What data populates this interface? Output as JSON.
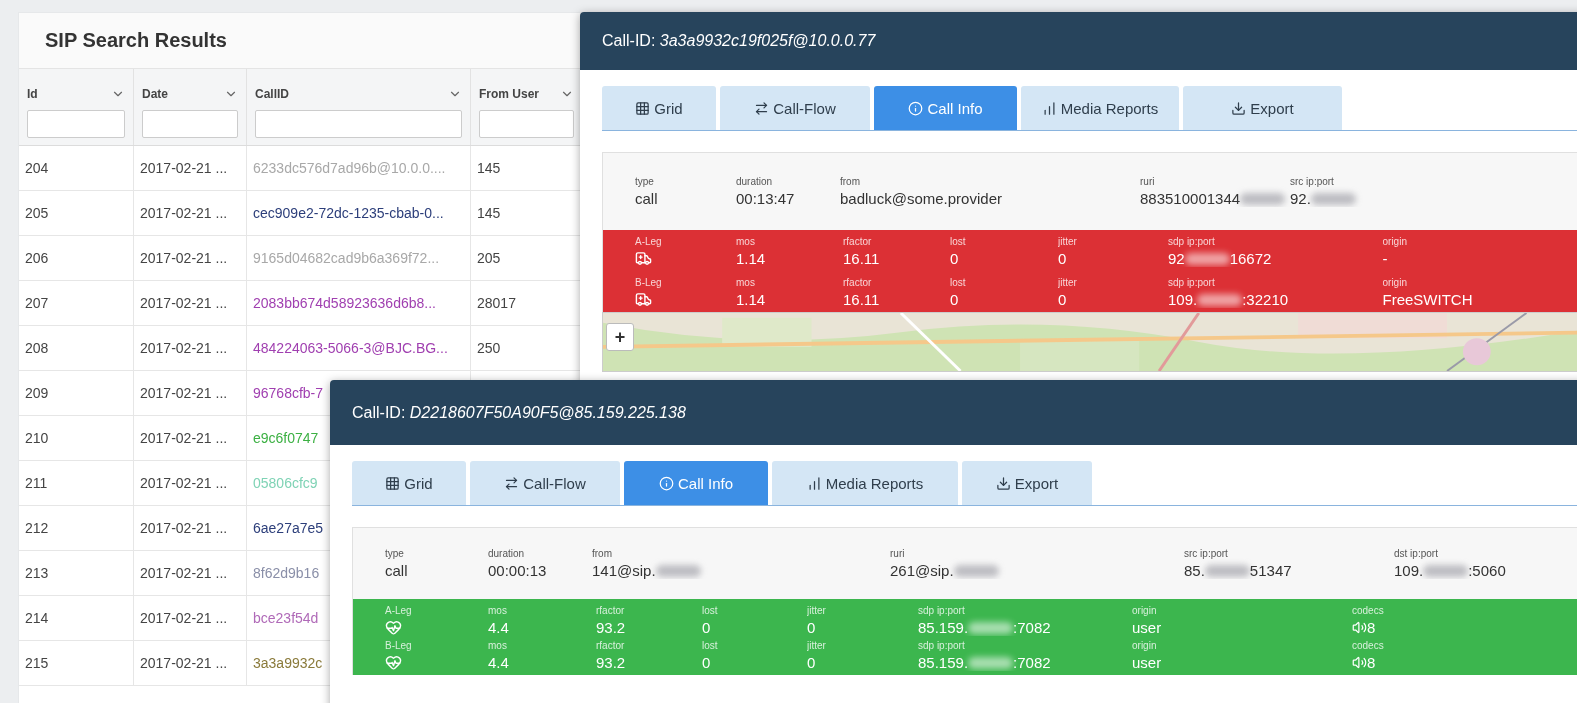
{
  "results": {
    "title": "SIP Search Results",
    "columns": [
      {
        "label": "Id"
      },
      {
        "label": "Date"
      },
      {
        "label": "CallID"
      },
      {
        "label": "From User"
      }
    ],
    "rows": [
      {
        "id": "204",
        "date": "2017-02-21 ...",
        "callid": "6233dc576d7ad96b@10.0.0....",
        "color": "#a8a8a8",
        "from_user": "145"
      },
      {
        "id": "205",
        "date": "2017-02-21 ...",
        "callid": "cec909e2-72dc-1235-cbab-0...",
        "color": "#2c3e7a",
        "from_user": "145"
      },
      {
        "id": "206",
        "date": "2017-02-21 ...",
        "callid": "9165d04682cad9b6a369f72...",
        "color": "#a8a8a8",
        "from_user": "205"
      },
      {
        "id": "207",
        "date": "2017-02-21 ...",
        "callid": "2083bb674d58923636d6b8...",
        "color": "#a03fb0",
        "from_user": "28017"
      },
      {
        "id": "208",
        "date": "2017-02-21 ...",
        "callid": "484224063-5066-3@BJC.BG...",
        "color": "#a03fb0",
        "from_user": "250"
      },
      {
        "id": "209",
        "date": "2017-02-21 ...",
        "callid": "96768cfb-7",
        "color": "#a03fb0"
      },
      {
        "id": "210",
        "date": "2017-02-21 ...",
        "callid": "e9c6f0747",
        "color": "#3cb043"
      },
      {
        "id": "211",
        "date": "2017-02-21 ...",
        "callid": "05806cfc9",
        "color": "#7fd3b5"
      },
      {
        "id": "212",
        "date": "2017-02-21 ...",
        "callid": "6ae27a7e5",
        "color": "#2c3e7a"
      },
      {
        "id": "213",
        "date": "2017-02-21 ...",
        "callid": "8f62d9b16",
        "color": "#8a8fa8"
      },
      {
        "id": "214",
        "date": "2017-02-21 ...",
        "callid": "bce23f54d",
        "color": "#b06ab8"
      },
      {
        "id": "215",
        "date": "2017-02-21 ...",
        "callid": "3a3a9932c",
        "color": "#8a7a3a"
      }
    ]
  },
  "dialogs": [
    {
      "title_label": "Call-ID:",
      "call_id": "3a3a9932c19f025f@10.0.0.77",
      "tabs": [
        {
          "label": "Grid",
          "selected": false
        },
        {
          "label": "Call-Flow",
          "selected": false
        },
        {
          "label": "Call Info",
          "selected": true
        },
        {
          "label": "Media Reports",
          "selected": false
        },
        {
          "label": "Export",
          "selected": false
        }
      ],
      "info": [
        {
          "label": "type",
          "segments": [
            {
              "text": "call"
            }
          ]
        },
        {
          "label": "duration",
          "segments": [
            {
              "text": "00:13:47"
            }
          ]
        },
        {
          "label": "from",
          "segments": [
            {
              "text": "badluck@some.provider"
            }
          ]
        },
        {
          "label": "ruri",
          "segments": [
            {
              "text": "883510001344"
            },
            {
              "kind": "blur"
            }
          ]
        },
        {
          "label": "src ip:port",
          "segments": [
            {
              "text": "92."
            },
            {
              "kind": "blur"
            }
          ]
        }
      ],
      "kind": "bad",
      "legs": [
        {
          "label": "A-Leg",
          "fields": [
            {
              "label": "mos",
              "segments": [
                {
                  "text": "1.14"
                }
              ]
            },
            {
              "label": "rfactor",
              "segments": [
                {
                  "text": "16.11"
                }
              ]
            },
            {
              "label": "lost",
              "segments": [
                {
                  "text": "0"
                }
              ]
            },
            {
              "label": "jitter",
              "segments": [
                {
                  "text": "0"
                }
              ]
            },
            {
              "label": "sdp ip:port",
              "segments": [
                {
                  "text": "92"
                },
                {
                  "kind": "blur"
                },
                {
                  "text": "16672"
                }
              ]
            },
            {
              "label": "origin",
              "segments": [
                {
                  "text": "-"
                }
              ]
            }
          ]
        },
        {
          "label": "B-Leg",
          "fields": [
            {
              "label": "mos",
              "segments": [
                {
                  "text": "1.14"
                }
              ]
            },
            {
              "label": "rfactor",
              "segments": [
                {
                  "text": "16.11"
                }
              ]
            },
            {
              "label": "lost",
              "segments": [
                {
                  "text": "0"
                }
              ]
            },
            {
              "label": "jitter",
              "segments": [
                {
                  "text": "0"
                }
              ]
            },
            {
              "label": "sdp ip:port",
              "segments": [
                {
                  "text": "109."
                },
                {
                  "kind": "blur"
                },
                {
                  "text": ":32210"
                }
              ]
            },
            {
              "label": "origin",
              "segments": [
                {
                  "text": "FreeSWITCH"
                }
              ]
            }
          ]
        }
      ],
      "map": {
        "kind": "picture",
        "zoom_in": "+"
      }
    },
    {
      "title_label": "Call-ID:",
      "call_id": "D2218607F50A90F5@85.159.225.138",
      "tabs": [
        {
          "label": "Grid",
          "selected": false
        },
        {
          "label": "Call-Flow",
          "selected": false
        },
        {
          "label": "Call Info",
          "selected": true
        },
        {
          "label": "Media Reports",
          "selected": false
        },
        {
          "label": "Export",
          "selected": false
        }
      ],
      "info": [
        {
          "label": "type",
          "segments": [
            {
              "text": "call"
            }
          ]
        },
        {
          "label": "duration",
          "segments": [
            {
              "text": "00:00:13"
            }
          ]
        },
        {
          "label": "from",
          "segments": [
            {
              "text": "141@sip."
            },
            {
              "kind": "blur"
            }
          ]
        },
        {
          "label": "ruri",
          "segments": [
            {
              "text": "261@sip."
            },
            {
              "kind": "blur"
            }
          ]
        },
        {
          "label": "src ip:port",
          "segments": [
            {
              "text": "85."
            },
            {
              "kind": "blur"
            },
            {
              "text": "51347"
            }
          ]
        },
        {
          "label": "dst ip:port",
          "segments": [
            {
              "text": "109."
            },
            {
              "kind": "blur"
            },
            {
              "text": ":5060"
            }
          ]
        }
      ],
      "kind": "good",
      "legs": [
        {
          "label": "A-Leg",
          "fields": [
            {
              "label": "mos",
              "segments": [
                {
                  "text": "4.4"
                }
              ]
            },
            {
              "label": "rfactor",
              "segments": [
                {
                  "text": "93.2"
                }
              ]
            },
            {
              "label": "lost",
              "segments": [
                {
                  "text": "0"
                }
              ]
            },
            {
              "label": "jitter",
              "segments": [
                {
                  "text": "0"
                }
              ]
            },
            {
              "label": "sdp ip:port",
              "segments": [
                {
                  "text": "85.159."
                },
                {
                  "kind": "blur"
                },
                {
                  "text": ":7082"
                }
              ]
            },
            {
              "label": "origin",
              "segments": [
                {
                  "text": "user"
                }
              ]
            },
            {
              "label": "codecs",
              "kind": "codec",
              "segments": [
                {
                  "text": "8"
                }
              ]
            }
          ]
        },
        {
          "label": "B-Leg",
          "fields": [
            {
              "label": "mos",
              "segments": [
                {
                  "text": "4.4"
                }
              ]
            },
            {
              "label": "rfactor",
              "segments": [
                {
                  "text": "93.2"
                }
              ]
            },
            {
              "label": "lost",
              "segments": [
                {
                  "text": "0"
                }
              ]
            },
            {
              "label": "jitter",
              "segments": [
                {
                  "text": "0"
                }
              ]
            },
            {
              "label": "sdp ip:port",
              "segments": [
                {
                  "text": "85.159."
                },
                {
                  "kind": "blur"
                },
                {
                  "text": ":7082"
                }
              ]
            },
            {
              "label": "origin",
              "segments": [
                {
                  "text": "user"
                }
              ]
            },
            {
              "label": "codecs",
              "kind": "codec",
              "segments": [
                {
                  "text": "8"
                }
              ]
            }
          ]
        }
      ]
    }
  ]
}
